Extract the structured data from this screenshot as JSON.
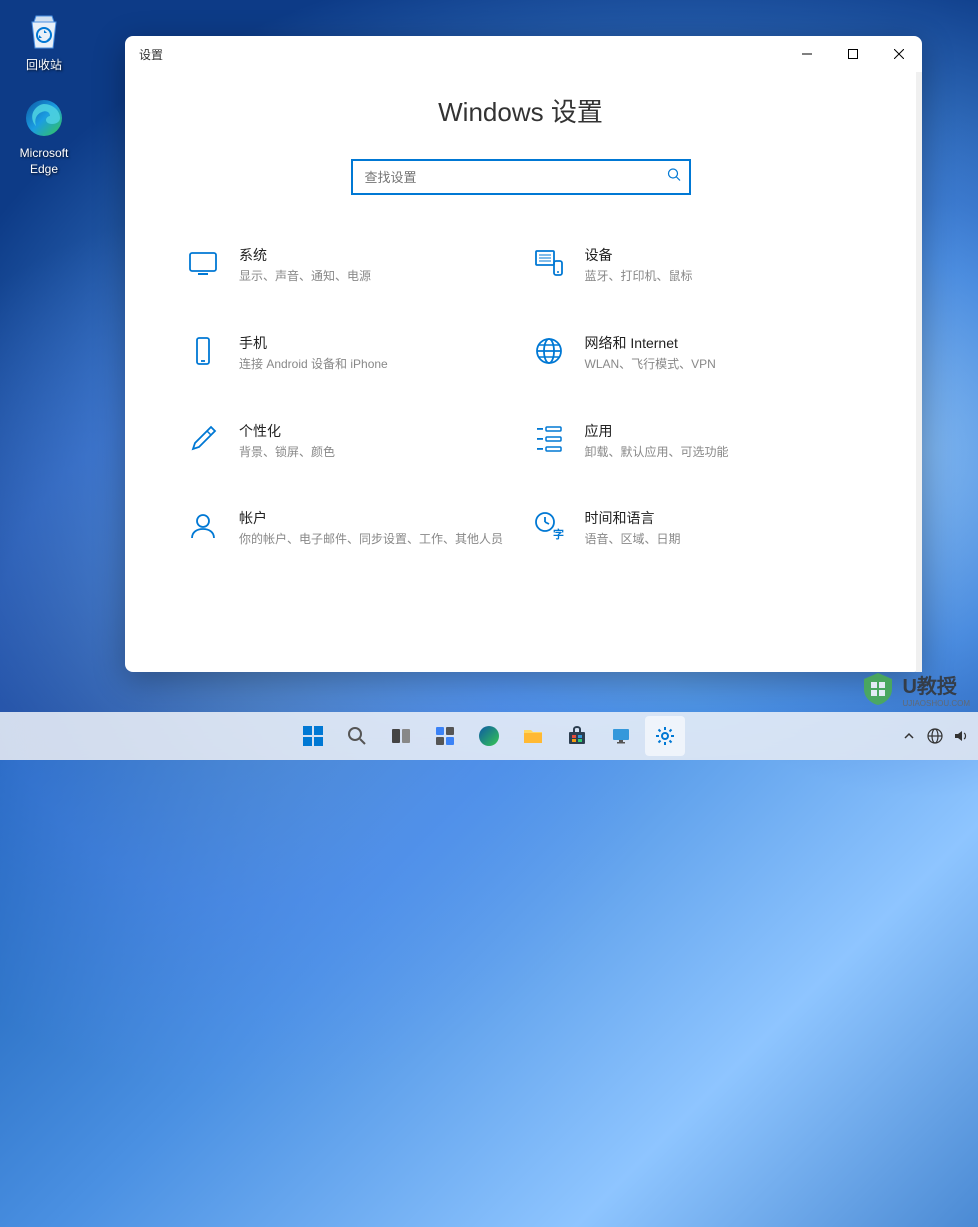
{
  "desktop": {
    "recycle_bin": "回收站",
    "edge": "Microsoft Edge"
  },
  "window": {
    "titlebar": "设置",
    "heading": "Windows 设置",
    "search_placeholder": "查找设置"
  },
  "settings": [
    {
      "icon": "system",
      "title": "系统",
      "desc": "显示、声音、通知、电源"
    },
    {
      "icon": "devices",
      "title": "设备",
      "desc": "蓝牙、打印机、鼠标"
    },
    {
      "icon": "phone",
      "title": "手机",
      "desc": "连接 Android 设备和 iPhone"
    },
    {
      "icon": "network",
      "title": "网络和 Internet",
      "desc": "WLAN、飞行模式、VPN"
    },
    {
      "icon": "personalization",
      "title": "个性化",
      "desc": "背景、锁屏、颜色"
    },
    {
      "icon": "apps",
      "title": "应用",
      "desc": "卸载、默认应用、可选功能"
    },
    {
      "icon": "accounts",
      "title": "帐户",
      "desc": "你的帐户、电子邮件、同步设置、工作、其他人员"
    },
    {
      "icon": "time",
      "title": "时间和语言",
      "desc": "语音、区域、日期"
    }
  ],
  "watermark": {
    "brand": "U教授",
    "sub": "UJIAOSHOU.COM"
  }
}
